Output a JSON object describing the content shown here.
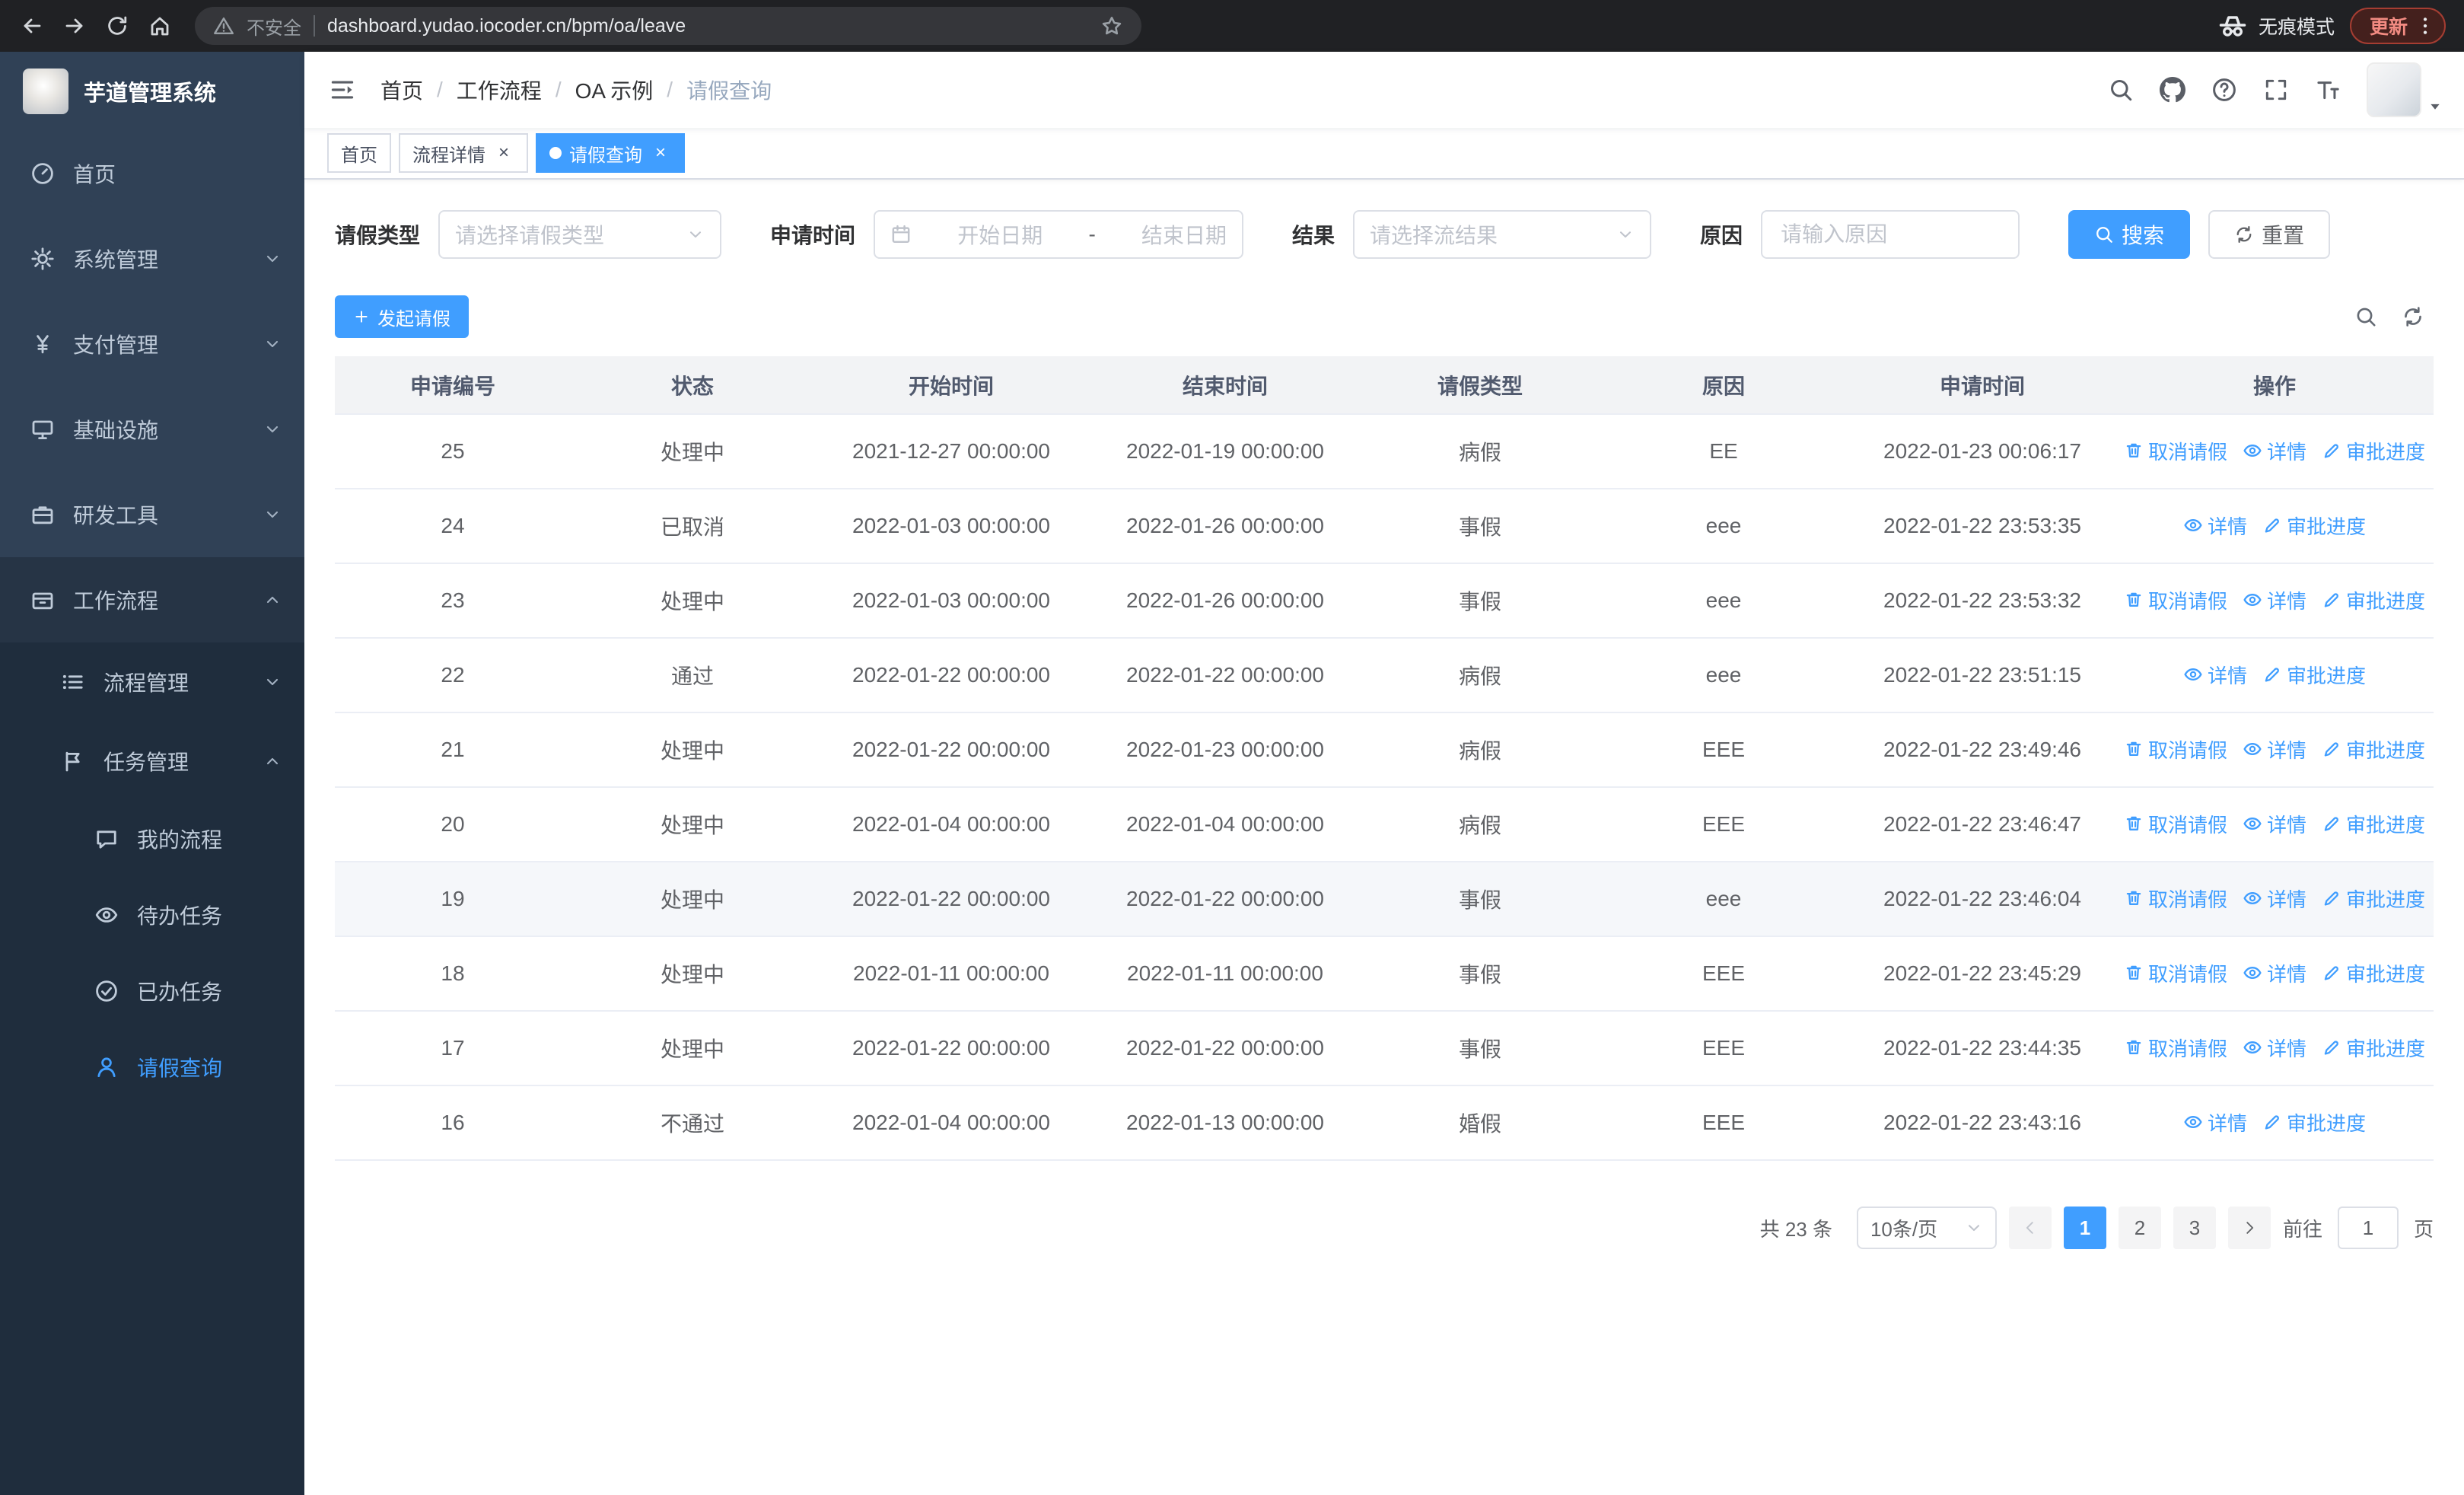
{
  "browser": {
    "security_label": "不安全",
    "url": "dashboard.yudao.iocoder.cn/bpm/oa/leave",
    "incognito_label": "无痕模式",
    "update_label": "更新"
  },
  "sidebar": {
    "logo_title": "芋道管理系统",
    "menu": [
      {
        "label": "首页",
        "icon": "dashboard-icon",
        "level": "top"
      },
      {
        "label": "系统管理",
        "icon": "gear-icon",
        "level": "top",
        "arrow": "down"
      },
      {
        "label": "支付管理",
        "icon": "payment-icon",
        "level": "top",
        "arrow": "down"
      },
      {
        "label": "基础设施",
        "icon": "infrastructure-icon",
        "level": "top",
        "arrow": "down"
      },
      {
        "label": "研发工具",
        "icon": "devtools-icon",
        "level": "top",
        "arrow": "down"
      },
      {
        "label": "工作流程",
        "icon": "workflow-icon",
        "level": "top",
        "arrow": "up",
        "open": true
      },
      {
        "label": "流程管理",
        "icon": "process-icon",
        "level": "sub1",
        "arrow": "down"
      },
      {
        "label": "任务管理",
        "icon": "task-icon",
        "level": "sub1",
        "arrow": "up",
        "open": true
      },
      {
        "label": "我的流程",
        "icon": "my-process-icon",
        "level": "sub2"
      },
      {
        "label": "待办任务",
        "icon": "todo-icon",
        "level": "sub2"
      },
      {
        "label": "已办任务",
        "icon": "done-icon",
        "level": "sub2"
      },
      {
        "label": "请假查询",
        "icon": "leave-icon",
        "level": "sub2",
        "active": true
      }
    ]
  },
  "header": {
    "breadcrumb": [
      "首页",
      "工作流程",
      "OA 示例",
      "请假查询"
    ]
  },
  "tabs": [
    {
      "label": "首页"
    },
    {
      "label": "流程详情",
      "closable": true
    },
    {
      "label": "请假查询",
      "closable": true,
      "active": true
    }
  ],
  "filters": {
    "leave_type_label": "请假类型",
    "leave_type_placeholder": "请选择请假类型",
    "apply_time_label": "申请时间",
    "start_placeholder": "开始日期",
    "range_separator": "-",
    "end_placeholder": "结束日期",
    "result_label": "结果",
    "result_placeholder": "请选择流结果",
    "reason_label": "原因",
    "reason_placeholder": "请输入原因",
    "search_label": "搜索",
    "reset_label": "重置"
  },
  "toolbar": {
    "create_label": "发起请假"
  },
  "table": {
    "columns": [
      "申请编号",
      "状态",
      "开始时间",
      "结束时间",
      "请假类型",
      "原因",
      "申请时间",
      "操作"
    ],
    "action_labels": {
      "cancel": "取消请假",
      "detail": "详情",
      "progress": "审批进度"
    },
    "rows": [
      {
        "id": "25",
        "status": "处理中",
        "start": "2021-12-27 00:00:00",
        "end": "2022-01-19 00:00:00",
        "type": "病假",
        "reason": "EE",
        "apply_time": "2022-01-23 00:06:17",
        "actions": [
          "cancel",
          "detail",
          "progress"
        ]
      },
      {
        "id": "24",
        "status": "已取消",
        "start": "2022-01-03 00:00:00",
        "end": "2022-01-26 00:00:00",
        "type": "事假",
        "reason": "eee",
        "apply_time": "2022-01-22 23:53:35",
        "actions": [
          "detail",
          "progress"
        ]
      },
      {
        "id": "23",
        "status": "处理中",
        "start": "2022-01-03 00:00:00",
        "end": "2022-01-26 00:00:00",
        "type": "事假",
        "reason": "eee",
        "apply_time": "2022-01-22 23:53:32",
        "actions": [
          "cancel",
          "detail",
          "progress"
        ]
      },
      {
        "id": "22",
        "status": "通过",
        "start": "2022-01-22 00:00:00",
        "end": "2022-01-22 00:00:00",
        "type": "病假",
        "reason": "eee",
        "apply_time": "2022-01-22 23:51:15",
        "actions": [
          "detail",
          "progress"
        ]
      },
      {
        "id": "21",
        "status": "处理中",
        "start": "2022-01-22 00:00:00",
        "end": "2022-01-23 00:00:00",
        "type": "病假",
        "reason": "EEE",
        "apply_time": "2022-01-22 23:49:46",
        "actions": [
          "cancel",
          "detail",
          "progress"
        ]
      },
      {
        "id": "20",
        "status": "处理中",
        "start": "2022-01-04 00:00:00",
        "end": "2022-01-04 00:00:00",
        "type": "病假",
        "reason": "EEE",
        "apply_time": "2022-01-22 23:46:47",
        "actions": [
          "cancel",
          "detail",
          "progress"
        ]
      },
      {
        "id": "19",
        "status": "处理中",
        "start": "2022-01-22 00:00:00",
        "end": "2022-01-22 00:00:00",
        "type": "事假",
        "reason": "eee",
        "apply_time": "2022-01-22 23:46:04",
        "actions": [
          "cancel",
          "detail",
          "progress"
        ],
        "hover": true
      },
      {
        "id": "18",
        "status": "处理中",
        "start": "2022-01-11 00:00:00",
        "end": "2022-01-11 00:00:00",
        "type": "事假",
        "reason": "EEE",
        "apply_time": "2022-01-22 23:45:29",
        "actions": [
          "cancel",
          "detail",
          "progress"
        ]
      },
      {
        "id": "17",
        "status": "处理中",
        "start": "2022-01-22 00:00:00",
        "end": "2022-01-22 00:00:00",
        "type": "事假",
        "reason": "EEE",
        "apply_time": "2022-01-22 23:44:35",
        "actions": [
          "cancel",
          "detail",
          "progress"
        ]
      },
      {
        "id": "16",
        "status": "不通过",
        "start": "2022-01-04 00:00:00",
        "end": "2022-01-13 00:00:00",
        "type": "婚假",
        "reason": "EEE",
        "apply_time": "2022-01-22 23:43:16",
        "actions": [
          "detail",
          "progress"
        ]
      }
    ]
  },
  "pagination": {
    "total_text": "共 23 条",
    "page_size_value": "10条/页",
    "pages": [
      "1",
      "2",
      "3"
    ],
    "active_page": "1",
    "goto_label": "前往",
    "goto_value": "1",
    "goto_unit": "页"
  },
  "colors": {
    "primary": "#409eff"
  }
}
